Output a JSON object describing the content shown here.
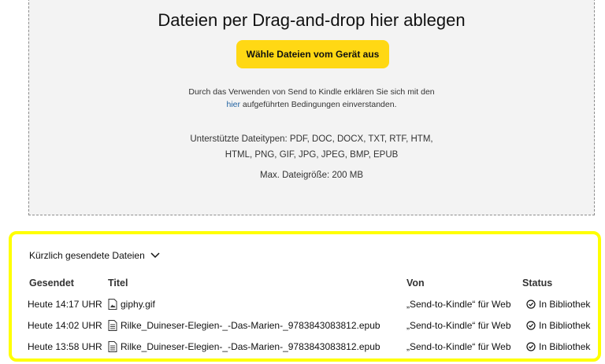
{
  "dropzone": {
    "title": "Dateien per Drag-and-drop hier ablegen",
    "choose_button": "Wähle Dateien vom Gerät aus",
    "terms_line1": "Durch das Verwenden von Send to Kindle erklären Sie sich mit den",
    "terms_link": "hier",
    "terms_line2_rest": " aufgeführten Bedingungen einverstanden.",
    "types_line1": "Unterstützte Dateitypen: PDF, DOC, DOCX, TXT, RTF, HTM,",
    "types_line2": "HTML, PNG, GIF, JPG, JPEG, BMP, EPUB",
    "max_size": "Max. Dateigröße: 200 MB"
  },
  "recent": {
    "heading": "Kürzlich gesendete Dateien",
    "highlight_color": "#ffff00",
    "columns": {
      "sent": "Gesendet",
      "title": "Titel",
      "from": "Von",
      "status": "Status"
    },
    "rows": [
      {
        "sent": "Heute 14:17 UHR",
        "icon": "image-file-icon",
        "title": "giphy.gif",
        "from": "„Send-to-Kindle“ für Web",
        "status": "In Bibliothek"
      },
      {
        "sent": "Heute 14:02 UHR",
        "icon": "document-file-icon",
        "title": "Rilke_Duineser-Elegien-_-Das-Marien-_9783843083812.epub",
        "from": "„Send-to-Kindle“ für Web",
        "status": "In Bibliothek"
      },
      {
        "sent": "Heute 13:58 UHR",
        "icon": "document-file-icon",
        "title": "Rilke_Duineser-Elegien-_-Das-Marien-_9783843083812.epub",
        "from": "„Send-to-Kindle“ für Web",
        "status": "In Bibliothek"
      }
    ]
  }
}
